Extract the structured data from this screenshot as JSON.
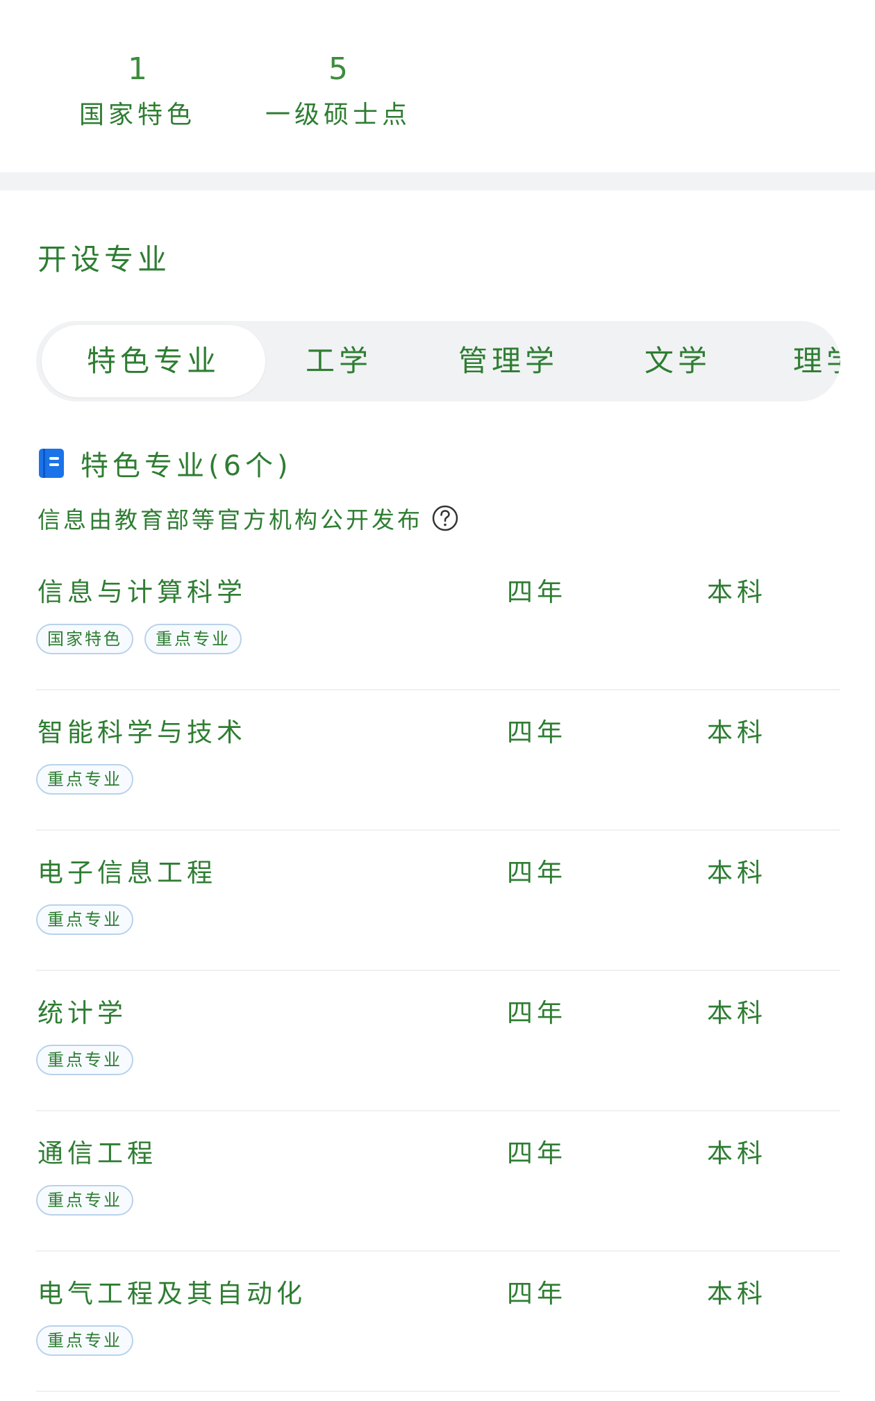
{
  "stats": [
    {
      "value": "1",
      "label": "国家特色"
    },
    {
      "value": "5",
      "label": "一级硕士点"
    }
  ],
  "section_title": "开设专业",
  "tabs": [
    {
      "label": "特色专业",
      "active": true
    },
    {
      "label": "工学",
      "active": false
    },
    {
      "label": "管理学",
      "active": false
    },
    {
      "label": "文学",
      "active": false
    },
    {
      "label": "理学",
      "active": false
    }
  ],
  "list": {
    "heading": "特色专业(6个)",
    "source_note": "信息由教育部等官方机构公开发布",
    "majors": [
      {
        "name": "信息与计算科学",
        "years": "四年",
        "degree": "本科",
        "tags": [
          "国家特色",
          "重点专业"
        ]
      },
      {
        "name": "智能科学与技术",
        "years": "四年",
        "degree": "本科",
        "tags": [
          "重点专业"
        ]
      },
      {
        "name": "电子信息工程",
        "years": "四年",
        "degree": "本科",
        "tags": [
          "重点专业"
        ]
      },
      {
        "name": "统计学",
        "years": "四年",
        "degree": "本科",
        "tags": [
          "重点专业"
        ]
      },
      {
        "name": "通信工程",
        "years": "四年",
        "degree": "本科",
        "tags": [
          "重点专业"
        ]
      },
      {
        "name": "电气工程及其自动化",
        "years": "四年",
        "degree": "本科",
        "tags": [
          "重点专业"
        ]
      }
    ]
  },
  "colors": {
    "text": "#2e7d32",
    "icon_blue": "#1a73e8",
    "tab_bg": "#f1f2f4",
    "tag_border": "#b9d2ea"
  }
}
